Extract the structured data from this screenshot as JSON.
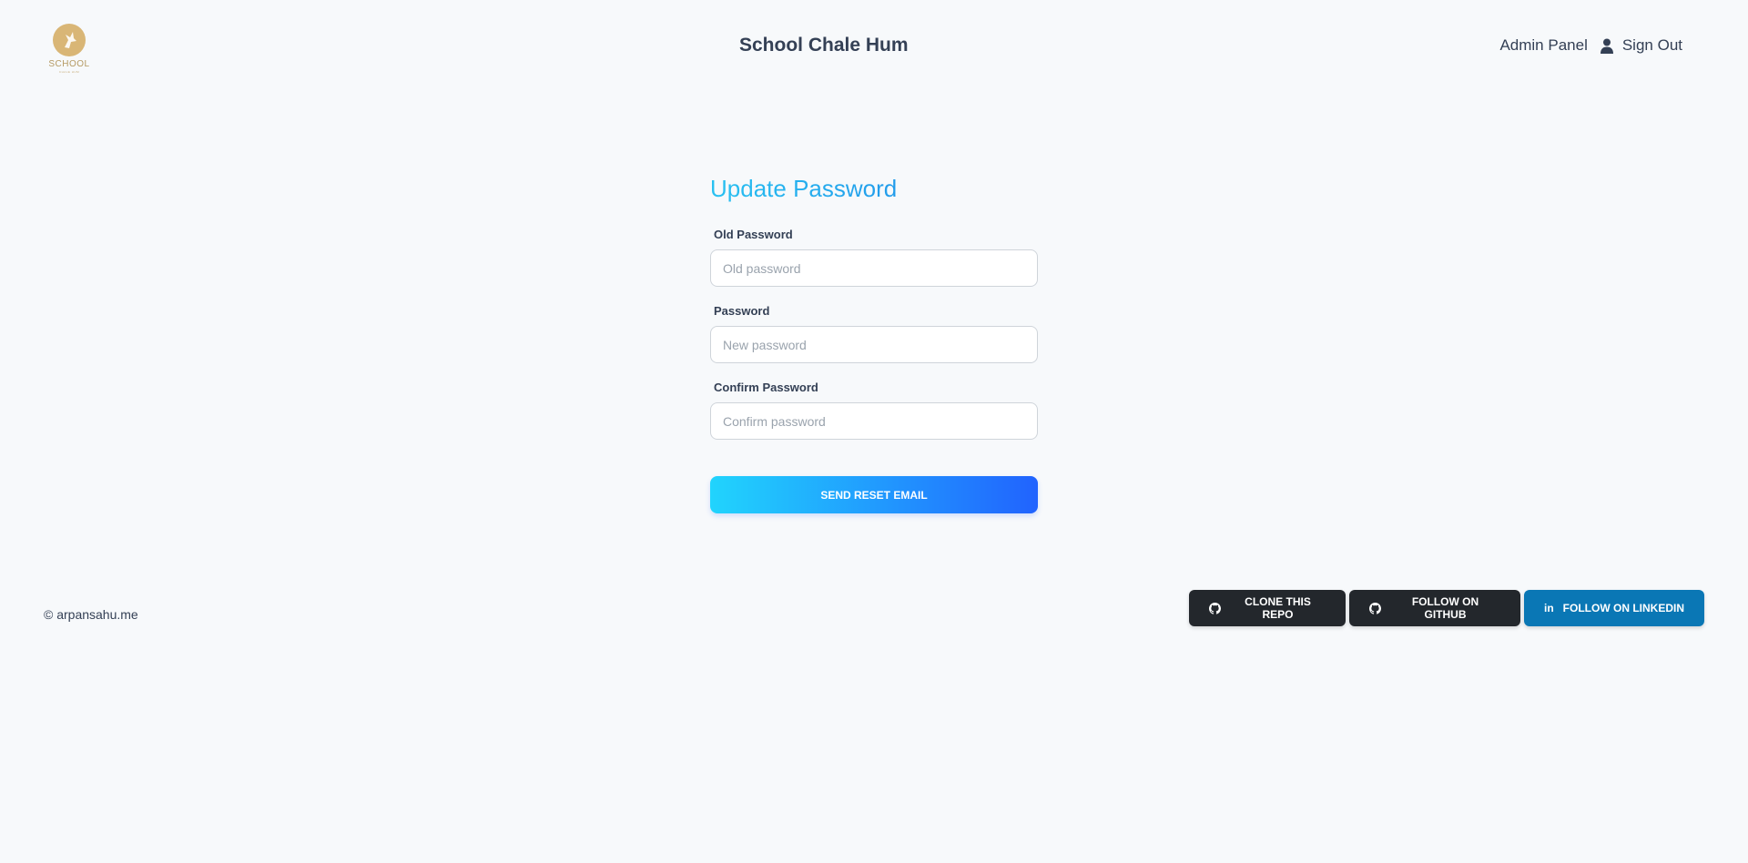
{
  "header": {
    "logo": {
      "text": "SCHOOL",
      "subtext": "CHALE HUM",
      "icon": "school-logo-icon"
    },
    "title": "School Chale Hum",
    "admin_label": "Admin Panel",
    "user_icon": "user-icon",
    "signout_label": "Sign Out"
  },
  "form": {
    "title": "Update Password",
    "fields": [
      {
        "label": "Old Password",
        "placeholder": "Old password",
        "value": ""
      },
      {
        "label": "Password",
        "placeholder": "New password",
        "value": ""
      },
      {
        "label": "Confirm Password",
        "placeholder": "Confirm password",
        "value": ""
      }
    ],
    "submit_label": "SEND RESET EMAIL"
  },
  "footer": {
    "copyright": "© arpansahu.me",
    "buttons": [
      {
        "label": "CLONE THIS REPO",
        "icon": "github-icon"
      },
      {
        "label": "FOLLOW ON GITHUB",
        "icon": "github-icon"
      },
      {
        "label": "FOLLOW ON LINKEDIN",
        "icon": "linkedin-icon"
      }
    ]
  },
  "colors": {
    "background": "#f7f9fb",
    "accent_gradient_start": "#21d4fd",
    "accent_gradient_end": "#2163fe",
    "dark_button": "#23272c",
    "linkedin_button": "#0a77b5",
    "logo_gold": "#d9b676"
  }
}
